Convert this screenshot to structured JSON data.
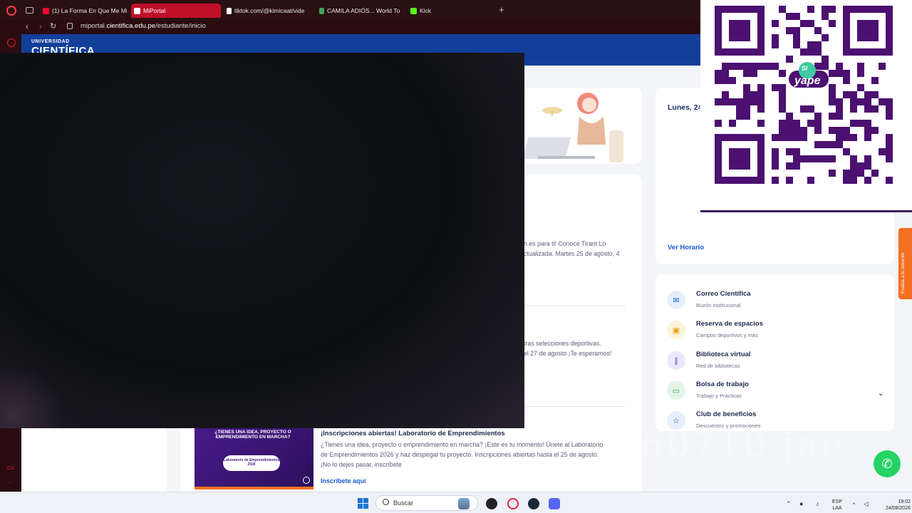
{
  "browser": {
    "tabs": [
      {
        "label": "(1) La Forma En Que Me Mi",
        "favicon_color": "#ff0033"
      },
      {
        "label": "MiPortal",
        "favicon_color": "#ffffff",
        "active": true
      },
      {
        "label": "tiktok.com/@kimicaat/vide",
        "favicon_color": "#ffffff"
      },
      {
        "label": "CAMILA ADIÓS... World To",
        "favicon_color": "#3ba55d"
      },
      {
        "label": "Kick",
        "favicon_color": "#53fc18"
      }
    ],
    "new_tab": "+",
    "url_prefix": "miportal.",
    "url_domain": "cientifica.edu.pe",
    "url_path": "/estudiante/inicio",
    "sidebar_label": "GX"
  },
  "header": {
    "logo_small": "UNIVERSIDAD",
    "logo_big": "CIENTÍFICA"
  },
  "calendar": {
    "date": "Lunes, 24",
    "link": "Ver Horario"
  },
  "news": {
    "item1_line1": "n es para ti! Conoce Tirant Lo",
    "item1_line2": "ctualizada. Martes 25 de agosto, 4",
    "item2_line1": "tras selecciones deportivas.",
    "item2_line2": "el 27 de agosto ¡Te esperamos!"
  },
  "lab": {
    "img_title": "¿TIENES UNA IDEA, PROYECTO O EMPRENDIMIENTO EN MARCHA?",
    "img_pill": "Laboratorio de Emprendimientos 2026",
    "title": "¡Inscripciones abiertas! Laboratorio de Emprendimientos",
    "line1": "¿Tienes una idea, proyecto o emprendimiento en marcha? ¡Este es tu momento! Únete al Laboratorio",
    "line2": "de Emprendimientos 2026 y haz despegar tu proyecto. Inscripciones abiertas hasta el 25 de agosto.",
    "line3": "¡No lo dejes pasar, inscríbete",
    "link": "Inscríbete aquí"
  },
  "quick_links": [
    {
      "title": "Correo Científica",
      "subtitle": "Buzón institucional",
      "icon": "outlook-icon",
      "color": "#0a64c8",
      "bg": "#e6effb"
    },
    {
      "title": "Reserva de espacios",
      "subtitle": "Campos deportivos y más",
      "icon": "calendar-icon",
      "color": "#e8a317",
      "bg": "#fdf3dc"
    },
    {
      "title": "Biblioteca virtual",
      "subtitle": "Red de bibliotecas",
      "icon": "books-icon",
      "color": "#6b4fd8",
      "bg": "#ece8fb"
    },
    {
      "title": "Bolsa de trabajo",
      "subtitle": "Trabajo y Prácticas",
      "icon": "briefcase-icon",
      "color": "#2aa84a",
      "bg": "#e3f5e8"
    },
    {
      "title": "Club de beneficios",
      "subtitle": "Descuentos y promociones",
      "icon": "star-icon",
      "color": "#1d57d3",
      "bg": "#e6effb"
    }
  ],
  "side_tab": "Evalúa a tu docente",
  "qr": {
    "brand": "yape",
    "symbol": "S/",
    "color": "#4b1070"
  },
  "watermark": "50710 jae",
  "taskbar": {
    "search_placeholder": "Buscar",
    "lang_line1": "ESP",
    "lang_line2": "LAA",
    "time": "19:02",
    "date": "24/08/2026"
  }
}
